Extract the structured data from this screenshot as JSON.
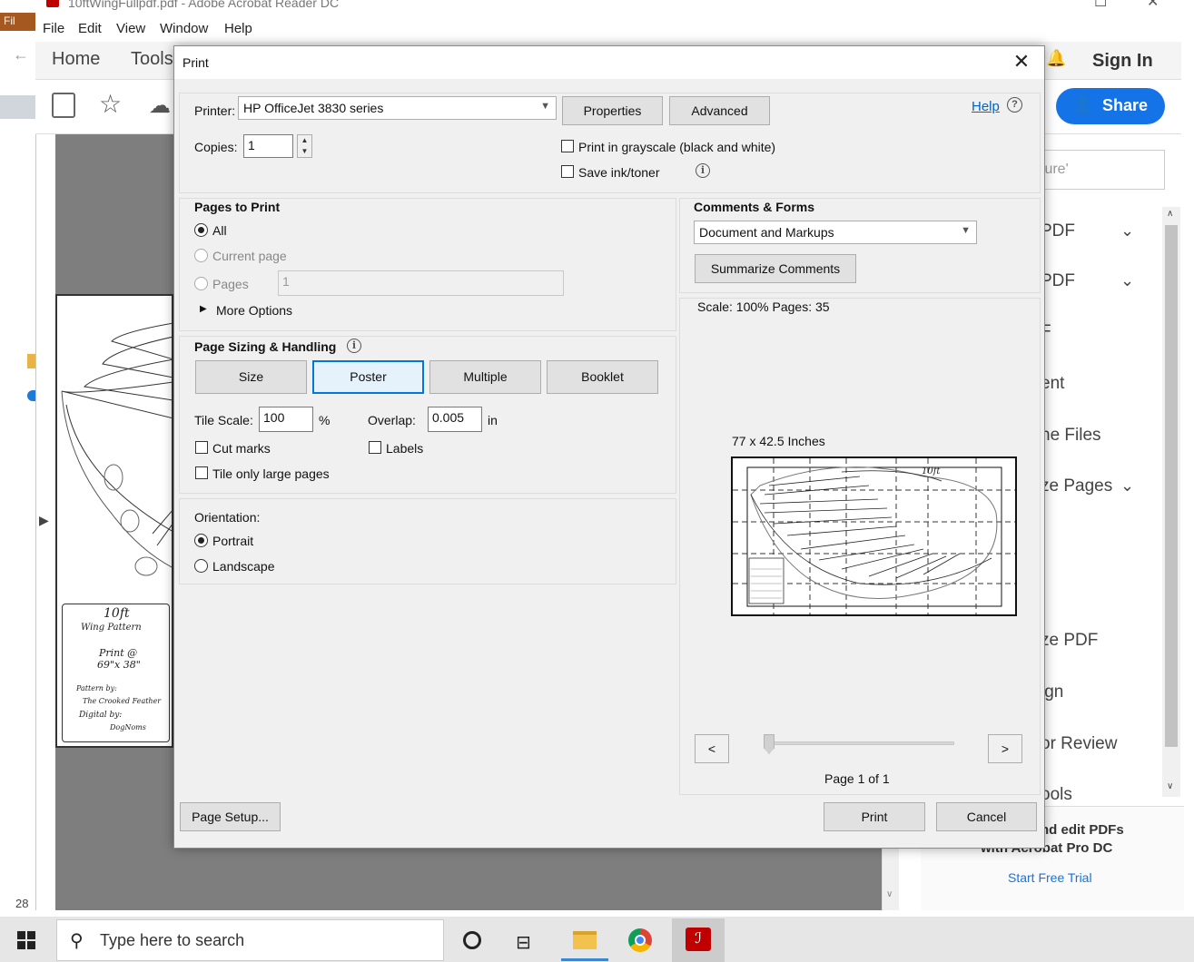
{
  "window": {
    "title": "10ftWingFullpdf.pdf - Adobe Acrobat Reader DC",
    "page_indicator": "28"
  },
  "menu": [
    "File",
    "Edit",
    "View",
    "Window",
    "Help"
  ],
  "app_nav": {
    "home": "Home",
    "tools": "Tools",
    "sign_in": "Sign In",
    "share": "Share"
  },
  "right_pane": {
    "search_placeholder": "ture'",
    "items": [
      "PDF",
      "PDF",
      "F",
      "ent",
      "ne Files",
      "ze Pages",
      "ze PDF",
      "ign",
      "or Review",
      "ools"
    ],
    "promo_line1": "nd edit PDFs",
    "promo_line2": "with Acrobat Pro DC",
    "trial_link": "Start Free Trial"
  },
  "doc_page": {
    "title": "10ft",
    "subtitle": "Wing Pattern",
    "print_line1": "Print @",
    "print_line2": "69\"x 38\"",
    "credit1": "Pattern by:",
    "credit2": "The Crooked Feather",
    "credit3": "Digital by:",
    "credit4": "DogNoms"
  },
  "taskbar": {
    "search_placeholder": "Type here to search"
  },
  "dialog": {
    "title": "Print",
    "printer_label": "Printer:",
    "printer_value": "HP OfficeJet 3830 series",
    "properties_button": "Properties",
    "advanced_button": "Advanced",
    "help_link": "Help",
    "copies_label": "Copies:",
    "copies_value": "1",
    "grayscale_label": "Print in grayscale (black and white)",
    "save_ink_label": "Save ink/toner",
    "pages_to_print": {
      "heading": "Pages to Print",
      "all": "All",
      "current_page": "Current page",
      "pages": "Pages",
      "pages_value": "1",
      "more_options": "More Options"
    },
    "page_sizing": {
      "heading": "Page Sizing & Handling",
      "tabs": [
        "Size",
        "Poster",
        "Multiple",
        "Booklet"
      ],
      "selected_tab": "Poster",
      "tile_scale_label": "Tile Scale:",
      "tile_scale_value": "100",
      "tile_scale_unit": "%",
      "overlap_label": "Overlap:",
      "overlap_value": "0.005",
      "overlap_unit": "in",
      "cut_marks": "Cut marks",
      "labels": "Labels",
      "tile_only_large": "Tile only large pages"
    },
    "orientation": {
      "heading": "Orientation:",
      "portrait": "Portrait",
      "landscape": "Landscape",
      "selected": "Portrait"
    },
    "comments_forms": {
      "heading": "Comments & Forms",
      "value": "Document and Markups",
      "summarize_button": "Summarize Comments"
    },
    "preview": {
      "scale_text": "Scale: 100% Pages: 35",
      "size_text": "77 x 42.5 Inches",
      "prev": "<",
      "next": ">",
      "page_text": "Page 1 of 1",
      "label_title": "10ft"
    },
    "page_setup_button": "Page Setup...",
    "print_button": "Print",
    "cancel_button": "Cancel"
  },
  "colors": {
    "accent": "#0078d7",
    "share_button": "#1473e6",
    "link": "#0563c1",
    "acrobat_red": "#c00000"
  }
}
